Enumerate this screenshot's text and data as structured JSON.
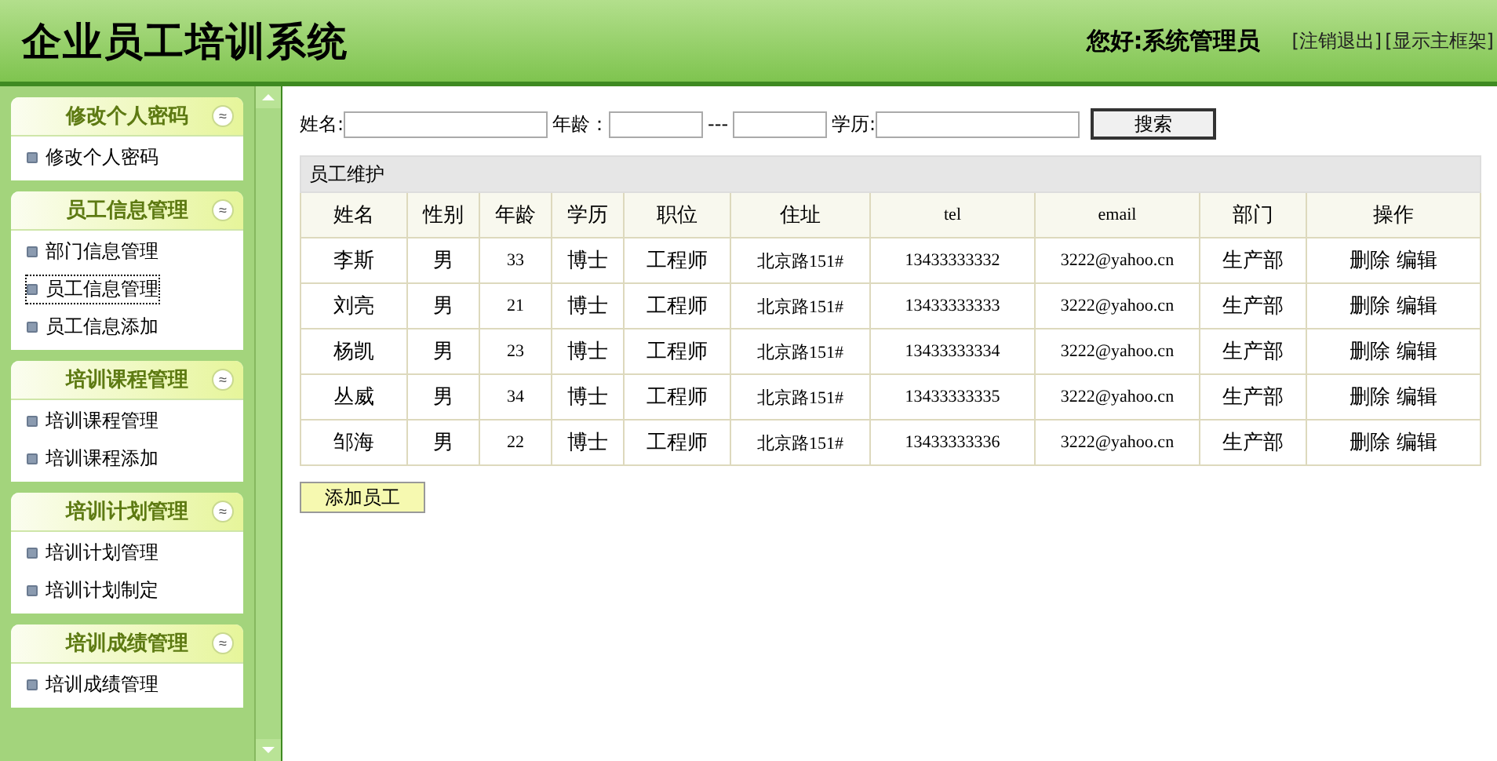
{
  "header": {
    "title": "企业员工培训系统",
    "greeting": "您好:系统管理员",
    "links": [
      "[注销退出]",
      "[显示主框架]"
    ]
  },
  "sidebar": {
    "groups": [
      {
        "title": "修改个人密码",
        "toggle": "≈",
        "items": [
          {
            "label": "修改个人密码",
            "selected": false
          }
        ]
      },
      {
        "title": "员工信息管理",
        "toggle": "≈",
        "items": [
          {
            "label": "部门信息管理",
            "selected": false
          },
          {
            "label": "员工信息管理",
            "selected": true
          },
          {
            "label": "员工信息添加",
            "selected": false
          }
        ]
      },
      {
        "title": "培训课程管理",
        "toggle": "≈",
        "items": [
          {
            "label": "培训课程管理",
            "selected": false
          },
          {
            "label": "培训课程添加",
            "selected": false
          }
        ]
      },
      {
        "title": "培训计划管理",
        "toggle": "≈",
        "items": [
          {
            "label": "培训计划管理",
            "selected": false
          },
          {
            "label": "培训计划制定",
            "selected": false
          }
        ]
      },
      {
        "title": "培训成绩管理",
        "toggle": "≈",
        "items": [
          {
            "label": "培训成绩管理",
            "selected": false
          }
        ]
      }
    ]
  },
  "search": {
    "name_label": "姓名:",
    "age_label": "年龄：",
    "age_separator": "---",
    "education_label": "学历:",
    "button": "搜索"
  },
  "table": {
    "caption": "员工维护",
    "columns": [
      "姓名",
      "性别",
      "年龄",
      "学历",
      "职位",
      "住址",
      "tel",
      "email",
      "部门",
      "操作"
    ],
    "rows": [
      {
        "cells": [
          "李斯",
          "男",
          "33",
          "博士",
          "工程师",
          "北京路151#",
          "13433333332",
          "3222@yahoo.cn",
          "生产部"
        ],
        "actions": [
          "删除",
          "编辑"
        ]
      },
      {
        "cells": [
          "刘亮",
          "男",
          "21",
          "博士",
          "工程师",
          "北京路151#",
          "13433333333",
          "3222@yahoo.cn",
          "生产部"
        ],
        "actions": [
          "删除",
          "编辑"
        ]
      },
      {
        "cells": [
          "杨凯",
          "男",
          "23",
          "博士",
          "工程师",
          "北京路151#",
          "13433333334",
          "3222@yahoo.cn",
          "生产部"
        ],
        "actions": [
          "删除",
          "编辑"
        ]
      },
      {
        "cells": [
          "丛威",
          "男",
          "34",
          "博士",
          "工程师",
          "北京路151#",
          "13433333335",
          "3222@yahoo.cn",
          "生产部"
        ],
        "actions": [
          "删除",
          "编辑"
        ]
      },
      {
        "cells": [
          "邹海",
          "男",
          "22",
          "博士",
          "工程师",
          "北京路151#",
          "13433333336",
          "3222@yahoo.cn",
          "生产部"
        ],
        "actions": [
          "删除",
          "编辑"
        ]
      }
    ]
  },
  "add_button": "添加员工"
}
